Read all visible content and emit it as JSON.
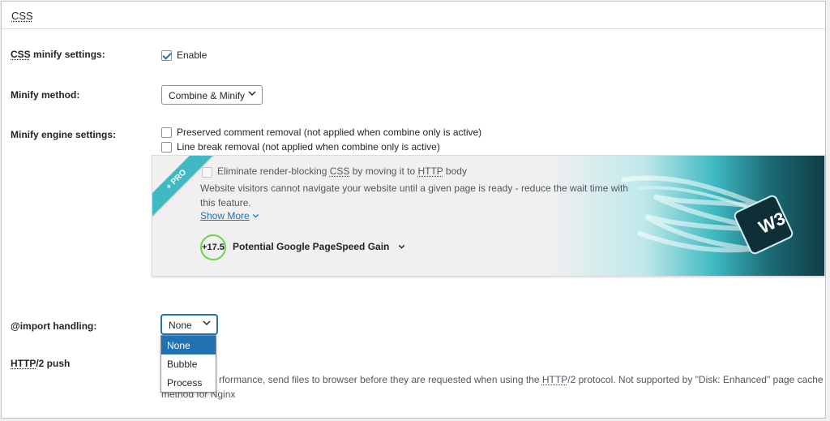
{
  "section": {
    "title": "CSS"
  },
  "css_minify": {
    "label_abbr": "CSS",
    "label_rest": " minify settings:",
    "checkbox_label": "Enable",
    "checked": true
  },
  "minify_method": {
    "label": "Minify method:",
    "value": "Combine & Minify"
  },
  "engine": {
    "label": "Minify engine settings:",
    "options": [
      {
        "label": "Preserved comment removal (not applied when combine only is active)",
        "checked": false
      },
      {
        "label": "Line break removal (not applied when combine only is active)",
        "checked": false
      }
    ]
  },
  "pro": {
    "ribbon": "+ PRO",
    "option_pre": "Eliminate render-blocking ",
    "option_abbr1": "CSS",
    "option_mid": " by moving it to ",
    "option_abbr2": "HTTP",
    "option_post": " body",
    "description_line1": "Website visitors cannot navigate your website until a given page is ready - reduce the wait time with",
    "description_line2": "this feature.",
    "show_more": "Show More",
    "gain_value": "+17.5",
    "gain_label": "Potential Google PageSpeed Gain",
    "logo_text": "W3"
  },
  "import_handling": {
    "label": "@import handling:",
    "value": "None",
    "options": [
      "None",
      "Bubble",
      "Process"
    ],
    "selected_index": 0
  },
  "http2": {
    "label_abbr": "HTTP",
    "label_rest": "/2 push",
    "help_pre": "rformance, send files to browser before they are requested when using the ",
    "help_abbr": "HTTP",
    "help_post": "/2 protocol. Not supported by \"Disk: Enhanced\" page cache",
    "help_line2": "method for Nginx"
  }
}
